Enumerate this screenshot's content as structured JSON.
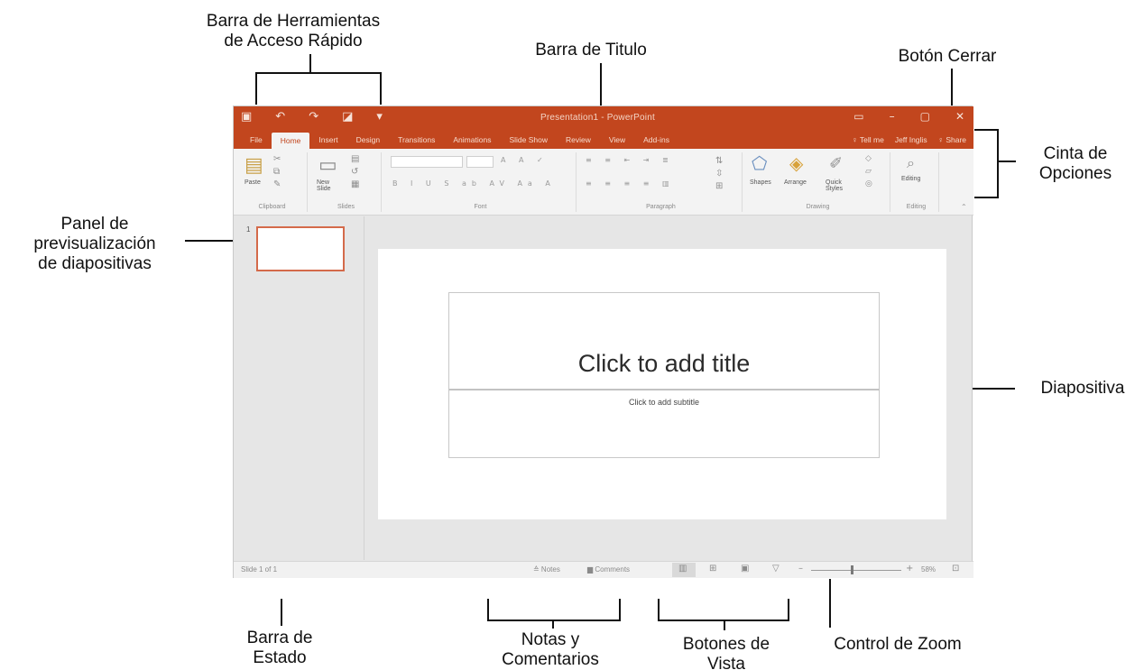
{
  "callouts": {
    "qat": "Barra de Herramientas\nde Acceso Rápido",
    "title_bar": "Barra de Titulo",
    "close_button": "Botón Cerrar",
    "ribbon": "Cinta de\nOpciones",
    "thumb_panel": "Panel de\nprevisualización\nde diapositivas",
    "slide": "Diapositiva",
    "status_bar": "Barra de\nEstado",
    "notes_comments": "Notas y\nComentarios",
    "view_buttons": "Botones de\nVista",
    "zoom_control": "Control de Zoom"
  },
  "window": {
    "doc_title": "Presentation1 - PowerPoint",
    "tabs": [
      "File",
      "Home",
      "Insert",
      "Design",
      "Transitions",
      "Animations",
      "Slide Show",
      "Review",
      "View",
      "Add-ins"
    ],
    "active_tab": "Home",
    "tell_me": "♀ Tell me",
    "user": "Jeff Inglis",
    "share": "♀ Share",
    "ribbon_groups": {
      "clipboard": "Clipboard",
      "slides": "Slides",
      "font": "Font",
      "paragraph": "Paragraph",
      "drawing": "Drawing",
      "editing": "Editing"
    },
    "ribbon_buttons": {
      "paste": "Paste",
      "new_slide": "New Slide",
      "shapes": "Shapes",
      "arrange": "Arrange",
      "quick_styles": "Quick Styles",
      "editing": "Editing"
    },
    "thumb_number": "1",
    "slide_title_placeholder": "Click to add title",
    "slide_subtitle_placeholder": "Click to add subtitle",
    "status": {
      "slide_counter": "Slide 1 of 1",
      "notes": "≙ Notes",
      "comments": "▆ Comments",
      "zoom_percent": "58%"
    }
  },
  "colors": {
    "accent": "#c2461e",
    "background": "#e6e6e6"
  }
}
